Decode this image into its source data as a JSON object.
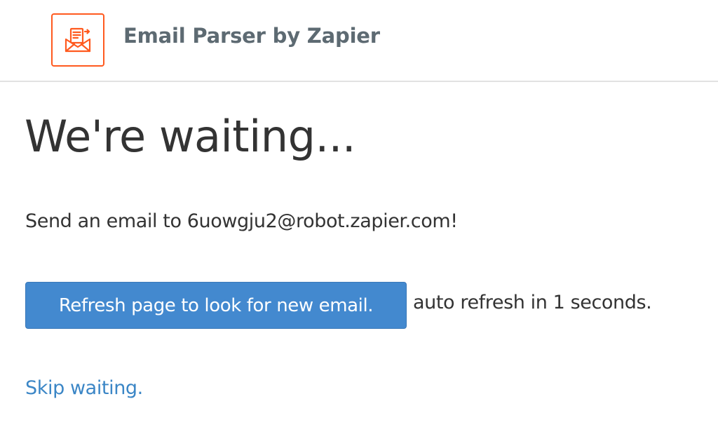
{
  "header": {
    "logo_icon": "envelope-document-icon",
    "brand_color": "#ff5a1f",
    "app_title": "Email Parser by Zapier"
  },
  "main": {
    "title": "We're waiting...",
    "instructions": "Send an email to 6uowgju2@robot.zapier.com!",
    "refresh_button_label": "Refresh page to look for new email.",
    "auto_refresh_text": "auto refresh in 1 seconds.",
    "skip_link_label": "Skip waiting.",
    "button_color": "#4389cf",
    "link_color": "#3b86c6"
  }
}
